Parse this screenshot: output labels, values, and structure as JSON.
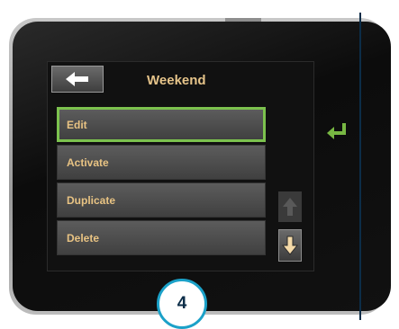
{
  "screen": {
    "title": "Weekend",
    "menu": [
      {
        "label": "Edit",
        "selected": true
      },
      {
        "label": "Activate",
        "selected": false
      },
      {
        "label": "Duplicate",
        "selected": false
      },
      {
        "label": "Delete",
        "selected": false
      }
    ]
  },
  "step_badge": "4",
  "icons": {
    "back": "left-arrow-icon",
    "scroll_up": "up-arrow-icon",
    "scroll_down": "down-arrow-icon",
    "enter": "return-arrow-icon"
  },
  "colors": {
    "menu_text": "#e8c383",
    "selected_border": "#7cc24e",
    "badge_border": "#1ba1c8",
    "enter_icon": "#78b843"
  }
}
